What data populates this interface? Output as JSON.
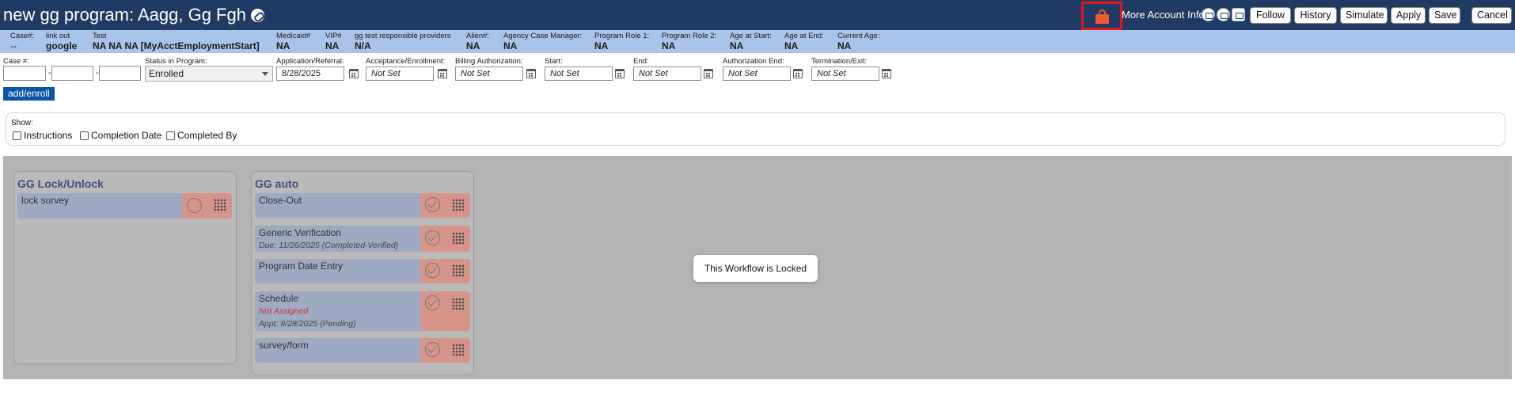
{
  "header": {
    "title": "new gg program: Aagg, Gg Fgh",
    "more_account_info": "More Account Info",
    "buttons": {
      "follow": "Follow",
      "history": "History",
      "simulate": "Simulate",
      "apply": "Apply",
      "save": "Save",
      "cancel": "Cancel"
    },
    "icons": [
      "link-icon",
      "lock-icon",
      "mail-icon",
      "chat-icon",
      "id-card-icon"
    ]
  },
  "info_bar": [
    {
      "label": "Case#:",
      "value": "--"
    },
    {
      "label": "link out",
      "value": "google"
    },
    {
      "label": "Test",
      "value": "NA NA NA [MyAcctEmploymentStart]"
    },
    {
      "label": "Medicaid#",
      "value": "NA"
    },
    {
      "label": "VIP#",
      "value": "NA"
    },
    {
      "label": "gg test responsible providers",
      "value": "N/A"
    },
    {
      "label": "Alien#:",
      "value": "NA"
    },
    {
      "label": "Agency Case Manager:",
      "value": "NA"
    },
    {
      "label": "Program Role 1:",
      "value": "NA"
    },
    {
      "label": "Program Role 2:",
      "value": "NA"
    },
    {
      "label": "Age at Start:",
      "value": "NA"
    },
    {
      "label": "Age at End:",
      "value": "NA"
    },
    {
      "label": "Current Age:",
      "value": "NA"
    }
  ],
  "form": {
    "case_label": "Case #:",
    "case_dash": "-",
    "status_label": "Status in Program:",
    "status_value": "Enrolled",
    "dates": [
      {
        "label": "Application/Referral:",
        "value": "8/28/2025"
      },
      {
        "label": "Acceptance/Enrollment:",
        "value": "Not Set"
      },
      {
        "label": "Billing Authorization:",
        "value": "Not Set"
      },
      {
        "label": "Start:",
        "value": "Not Set"
      },
      {
        "label": "End:",
        "value": "Not Set"
      },
      {
        "label": "Authorization End:",
        "value": "Not Set"
      },
      {
        "label": "Termination/Exit:",
        "value": "Not Set"
      }
    ],
    "add_enroll": "add/enroll"
  },
  "show_panel": {
    "label": "Show:",
    "options": [
      "Instructions",
      "Completion Date",
      "Completed By"
    ]
  },
  "workflow": {
    "locked_message": "This Workflow is Locked",
    "columns": [
      {
        "title": "GG Lock/Unlock",
        "tasks": [
          {
            "name": "lock survey",
            "status": "open"
          }
        ]
      },
      {
        "title": "GG auto",
        "tasks": [
          {
            "name": "Close-Out",
            "status": "done"
          },
          {
            "name": "Generic Verification",
            "due": "Due: 11/26/2025 (Completed-Verified)",
            "status": "done"
          },
          {
            "name": "Program Date Entry",
            "status": "done"
          },
          {
            "name": "Schedule",
            "assigned": "Not Assigned",
            "appt": "Appt: 8/28/2025 (Pending)",
            "status": "done"
          },
          {
            "name": "survey/form",
            "status": "done"
          }
        ]
      }
    ]
  },
  "colors": {
    "header_bg": "#1f3b63",
    "info_bar_bg": "#a9c4ea",
    "lock_icon": "#f05a32",
    "lock_highlight": "#e2141b",
    "task_bg": "#9daac1",
    "task_action_bg": "#d7958a",
    "not_assigned": "#d4322e",
    "add_enroll_bg": "#0b55a9"
  }
}
